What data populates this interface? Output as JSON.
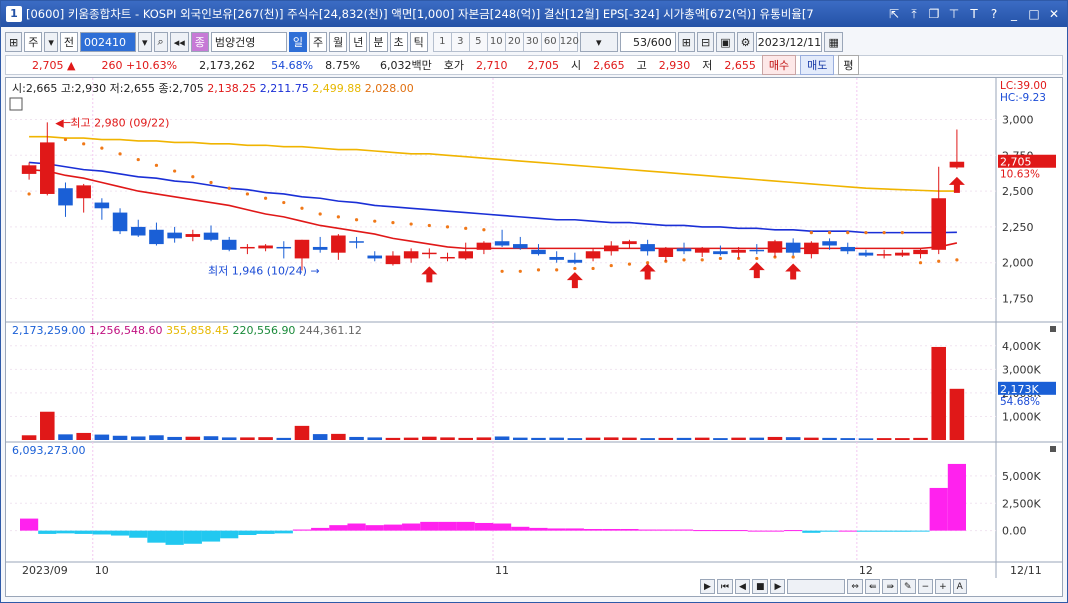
{
  "window": {
    "number": "1",
    "title": "[0600] 키움종합차트 - KOSPI 외국인보유[267(천)] 주식수[24,832(천)] 액면[1,000] 자본금[248(억)] 결산[12월] EPS[-324] 시가총액[672(억)] 유통비율[7"
  },
  "toolbar": {
    "period_type": "주",
    "prev": "전",
    "code": "002410",
    "stock_name": "범양건영",
    "tabs": [
      "일",
      "주",
      "월",
      "년",
      "분",
      "초",
      "틱"
    ],
    "intervals": [
      "1",
      "3",
      "5",
      "10",
      "20",
      "30",
      "60",
      "120"
    ],
    "count": "53/600",
    "date": "2023/12/11"
  },
  "quote": {
    "price": "2,705",
    "arrow": "▲",
    "change": "260",
    "change_pct": "+10.63%",
    "volume": "2,173,262",
    "ratio": "54.68%",
    "turnover": "8.75%",
    "amount": "6,032백만",
    "hoga_label": "호가",
    "ask": "2,710",
    "bid": "2,705",
    "open_label": "시",
    "open": "2,665",
    "high_label": "고",
    "high": "2,930",
    "low_label": "저",
    "low": "2,655",
    "buy": "매수",
    "sell": "매도",
    "eval": "평"
  },
  "price_legend": {
    "ohlc": "시:2,665 고:2,930 저:2,655 종:2,705",
    "ma1": "2,138.25",
    "ma2": "2,211.75",
    "ma3": "2,499.88",
    "ma4": "2,028.00",
    "lc": "LC:39.00",
    "hc": "HC:-9.23"
  },
  "volume_legend": {
    "v1": "2,173,259.00",
    "v2": "1,256,548.60",
    "v3": "355,858.45",
    "v4": "220,556.90",
    "v5": "244,361.12"
  },
  "osc_legend": {
    "v1": "6,093,273.00"
  },
  "colors": {
    "up": "#e01818",
    "down": "#1a5fd6",
    "ma_short": "#e01818",
    "ma_mid": "#1a2fd6",
    "ma_long": "#f0b400",
    "psar": "#f07818",
    "osc_pos": "#ff22ee",
    "osc_neg": "#22c8f0"
  },
  "chart_data": {
    "type": "candlestick",
    "x": [
      "2023/09",
      "10",
      "11",
      "12",
      "12/11"
    ],
    "price_axis": {
      "ticks": [
        "3,000",
        "2,750",
        "2,500",
        "2,250",
        "2,000",
        "1,750"
      ],
      "ylim": [
        1600,
        3150
      ]
    },
    "volume_axis": {
      "ticks": [
        "4,000K",
        "3,000K",
        "2,000K",
        "1,000K"
      ],
      "ylim": [
        0,
        4500000
      ]
    },
    "osc_axis": {
      "ticks": [
        "5,000K",
        "2,500K",
        "0.00"
      ],
      "ylim": [
        -2500000,
        7000000
      ]
    },
    "current_price_label": "2,705",
    "current_pct_label": "10.63%",
    "current_volume_label": "2,173K",
    "current_volume_pct": "54.68%",
    "annotations": [
      {
        "text": "최고 2,980 (09/22)"
      },
      {
        "text": "최저 1,946 (10/24)"
      }
    ],
    "candles": [
      [
        2620,
        2700,
        2580,
        2680
      ],
      [
        2480,
        2980,
        2470,
        2840
      ],
      [
        2520,
        2560,
        2320,
        2400
      ],
      [
        2450,
        2550,
        2350,
        2540
      ],
      [
        2420,
        2450,
        2300,
        2380
      ],
      [
        2350,
        2380,
        2200,
        2220
      ],
      [
        2250,
        2300,
        2180,
        2190
      ],
      [
        2230,
        2280,
        2120,
        2130
      ],
      [
        2210,
        2250,
        2140,
        2170
      ],
      [
        2180,
        2230,
        2150,
        2200
      ],
      [
        2210,
        2260,
        2150,
        2160
      ],
      [
        2160,
        2180,
        2080,
        2090
      ],
      [
        2100,
        2130,
        2060,
        2110
      ],
      [
        2100,
        2130,
        2080,
        2120
      ],
      [
        2110,
        2150,
        2030,
        2100
      ],
      [
        2030,
        2160,
        1946,
        2160
      ],
      [
        2110,
        2180,
        2070,
        2090
      ],
      [
        2070,
        2200,
        2020,
        2190
      ],
      [
        2150,
        2180,
        2100,
        2140
      ],
      [
        2050,
        2080,
        2010,
        2030
      ],
      [
        1990,
        2080,
        1980,
        2050
      ],
      [
        2030,
        2100,
        2000,
        2080
      ],
      [
        2060,
        2100,
        2030,
        2070
      ],
      [
        2030,
        2070,
        2010,
        2040
      ],
      [
        2030,
        2140,
        2020,
        2080
      ],
      [
        2090,
        2150,
        2060,
        2140
      ],
      [
        2150,
        2230,
        2110,
        2120
      ],
      [
        2130,
        2180,
        2090,
        2100
      ],
      [
        2090,
        2130,
        2050,
        2060
      ],
      [
        2040,
        2080,
        2000,
        2020
      ],
      [
        2020,
        2070,
        1990,
        2000
      ],
      [
        2030,
        2100,
        2010,
        2080
      ],
      [
        2080,
        2150,
        2050,
        2120
      ],
      [
        2130,
        2160,
        2100,
        2150
      ],
      [
        2130,
        2160,
        2050,
        2080
      ],
      [
        2040,
        2110,
        2010,
        2100
      ],
      [
        2100,
        2140,
        2060,
        2080
      ],
      [
        2070,
        2110,
        2040,
        2100
      ],
      [
        2080,
        2120,
        2050,
        2060
      ],
      [
        2070,
        2110,
        2030,
        2090
      ],
      [
        2090,
        2130,
        2060,
        2080
      ],
      [
        2070,
        2160,
        2040,
        2150
      ],
      [
        2140,
        2170,
        2050,
        2070
      ],
      [
        2060,
        2150,
        2030,
        2140
      ],
      [
        2150,
        2170,
        2090,
        2120
      ],
      [
        2110,
        2140,
        2060,
        2080
      ],
      [
        2070,
        2090,
        2040,
        2050
      ],
      [
        2050,
        2090,
        2030,
        2060
      ],
      [
        2050,
        2090,
        2040,
        2070
      ],
      [
        2060,
        2100,
        2030,
        2090
      ],
      [
        2090,
        2670,
        2060,
        2450
      ],
      [
        2665,
        2930,
        2655,
        2705
      ]
    ],
    "ma_short": [
      2650,
      2640,
      2610,
      2590,
      2560,
      2530,
      2500,
      2480,
      2460,
      2440,
      2420,
      2400,
      2370,
      2340,
      2320,
      2290,
      2260,
      2240,
      2220,
      2200,
      2170,
      2150,
      2130,
      2110,
      2100,
      2100,
      2100,
      2100,
      2100,
      2100,
      2100,
      2100,
      2100,
      2100,
      2100,
      2100,
      2100,
      2100,
      2100,
      2100,
      2100,
      2100,
      2100,
      2100,
      2100,
      2100,
      2100,
      2100,
      2100,
      2100,
      2110,
      2138
    ],
    "ma_mid": [
      2700,
      2690,
      2670,
      2650,
      2640,
      2620,
      2600,
      2590,
      2570,
      2560,
      2540,
      2520,
      2510,
      2490,
      2480,
      2460,
      2450,
      2430,
      2420,
      2400,
      2390,
      2380,
      2370,
      2360,
      2350,
      2340,
      2330,
      2320,
      2310,
      2300,
      2300,
      2290,
      2280,
      2280,
      2270,
      2260,
      2260,
      2250,
      2250,
      2240,
      2240,
      2230,
      2230,
      2220,
      2220,
      2220,
      2210,
      2210,
      2210,
      2210,
      2210,
      2212
    ],
    "ma_long": [
      2880,
      2880,
      2870,
      2870,
      2860,
      2860,
      2850,
      2850,
      2840,
      2840,
      2830,
      2830,
      2820,
      2820,
      2810,
      2810,
      2800,
      2790,
      2790,
      2780,
      2770,
      2760,
      2760,
      2750,
      2740,
      2730,
      2720,
      2710,
      2700,
      2690,
      2680,
      2670,
      2660,
      2650,
      2640,
      2630,
      2620,
      2610,
      2600,
      2590,
      2580,
      2570,
      2560,
      2550,
      2540,
      2530,
      2520,
      2515,
      2510,
      2505,
      2500,
      2500
    ],
    "psar": [
      2480,
      2500,
      2860,
      2830,
      2800,
      2760,
      2720,
      2680,
      2640,
      2600,
      2560,
      2520,
      2480,
      2450,
      2420,
      2380,
      2340,
      2320,
      2300,
      2290,
      2280,
      2270,
      2260,
      2250,
      2240,
      2230,
      1940,
      1940,
      1950,
      1950,
      1960,
      1960,
      1980,
      1990,
      2000,
      2010,
      2020,
      2020,
      2030,
      2030,
      2030,
      2040,
      2040,
      2210,
      2210,
      2210,
      2210,
      2210,
      2210,
      2000,
      2010,
      2020
    ],
    "signals_idx": [
      22,
      30,
      34,
      40,
      42,
      51
    ],
    "volumes": [
      200000,
      1200000,
      240000,
      300000,
      230000,
      180000,
      150000,
      200000,
      130000,
      140000,
      160000,
      110000,
      110000,
      120000,
      90000,
      600000,
      250000,
      260000,
      130000,
      110000,
      90000,
      100000,
      140000,
      110000,
      90000,
      110000,
      150000,
      100000,
      90000,
      100000,
      80000,
      100000,
      110000,
      100000,
      80000,
      90000,
      90000,
      100000,
      80000,
      100000,
      100000,
      130000,
      120000,
      100000,
      90000,
      80000,
      70000,
      80000,
      80000,
      90000,
      3950000,
      2173259
    ],
    "osc": [
      1100000,
      -300000,
      -250000,
      -300000,
      -350000,
      -450000,
      -650000,
      -1100000,
      -1300000,
      -1200000,
      -1000000,
      -700000,
      -400000,
      -300000,
      -250000,
      100000,
      250000,
      500000,
      650000,
      500000,
      550000,
      650000,
      800000,
      800000,
      800000,
      700000,
      650000,
      350000,
      250000,
      200000,
      200000,
      150000,
      150000,
      150000,
      100000,
      100000,
      100000,
      50000,
      50000,
      50000,
      0,
      0,
      50000,
      -200000,
      -100000,
      0,
      -100000,
      -100000,
      -100000,
      -50000,
      3900000,
      6093273
    ]
  },
  "nav": {
    "a_label": "A"
  }
}
